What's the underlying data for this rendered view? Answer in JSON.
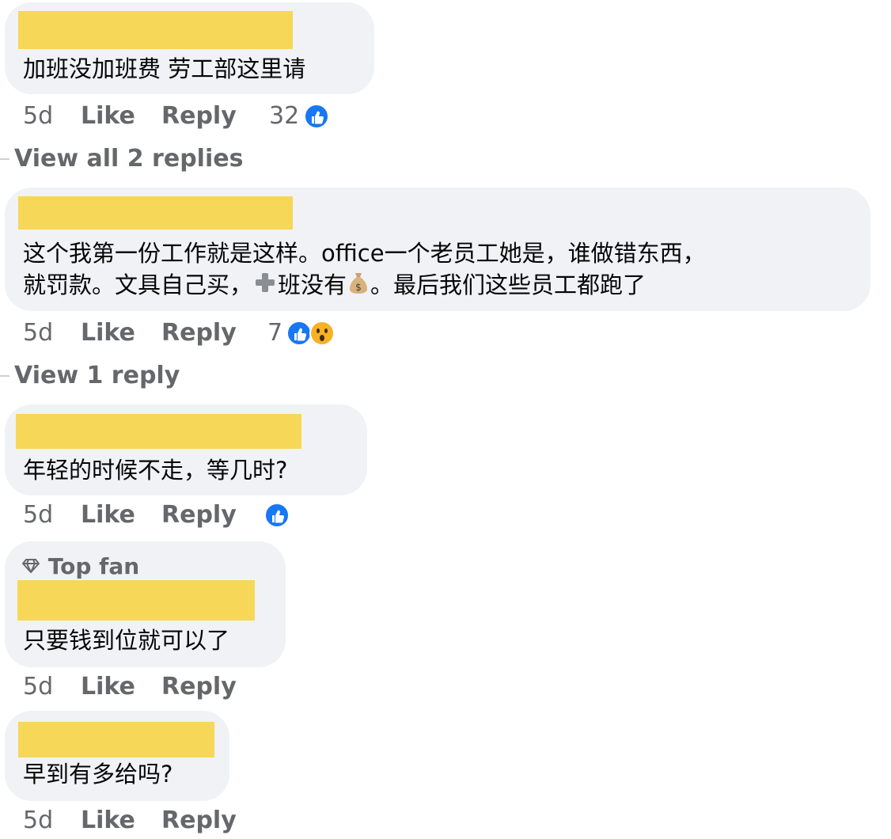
{
  "comments": [
    {
      "lines": [
        "加班没加班费 劳工部这里请"
      ],
      "time": "5d",
      "like": "Like",
      "reply": "Reply",
      "reaction_count": "32",
      "reactions": [
        "like-icon"
      ],
      "view_replies": "View all 2 replies"
    },
    {
      "lines": [
        "这个我第一份工作就是这样。office一个老员工她是，谁做错东西，",
        [
          "就罚款。文具自己买，",
          "班没有",
          "。最后我们这些员工都跑了"
        ]
      ],
      "inline_icons": [
        "plus-icon",
        "money-bag-icon"
      ],
      "time": "5d",
      "like": "Like",
      "reply": "Reply",
      "reaction_count": "7",
      "reactions": [
        "like-icon",
        "wow-icon"
      ],
      "view_replies": "View 1 reply"
    },
    {
      "lines": [
        "年轻的时候不走，等几时?"
      ],
      "time": "5d",
      "like": "Like",
      "reply": "Reply",
      "reaction_count": "",
      "reactions": [
        "like-icon"
      ]
    },
    {
      "badge": "Top fan",
      "badge_icon": "diamond-icon",
      "lines": [
        "只要钱到位就可以了"
      ],
      "time": "5d",
      "like": "Like",
      "reply": "Reply"
    },
    {
      "lines": [
        "早到有多给吗?"
      ],
      "time": "5d",
      "like": "Like",
      "reply": "Reply"
    }
  ],
  "colors": {
    "bubble": "#f0f2f5",
    "redaction": "#f7d758",
    "secondary_text": "#65676b",
    "like_blue": "#1877f2",
    "wow_yellow": "#f7b125"
  }
}
